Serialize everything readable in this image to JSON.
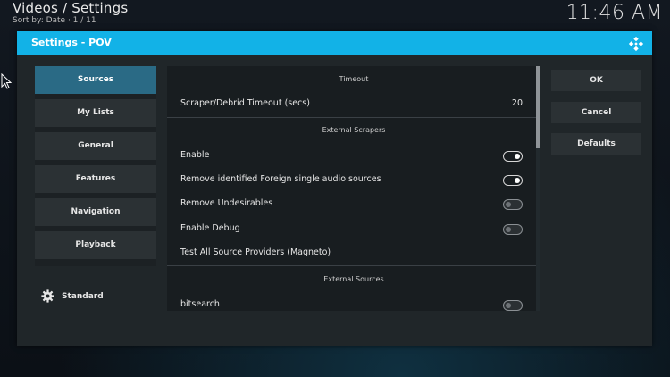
{
  "background": {
    "title": "Videos / Settings",
    "sort_info": "Sort by: Date  ·  1 / 11",
    "clock": "11:46 AM"
  },
  "dialog": {
    "title": "Settings - POV",
    "accent_color": "#12b2e7"
  },
  "categories": [
    {
      "label": "Sources"
    },
    {
      "label": "My Lists"
    },
    {
      "label": "General"
    },
    {
      "label": "Features"
    },
    {
      "label": "Navigation"
    },
    {
      "label": "Playback"
    }
  ],
  "settings_level": {
    "label": "Standard"
  },
  "sections": {
    "timeout": {
      "header": "Timeout",
      "scraper_timeout": {
        "label": "Scraper/Debrid Timeout (secs)",
        "value": "20"
      }
    },
    "external_scrapers": {
      "header": "External Scrapers",
      "enable": {
        "label": "Enable",
        "state": "on"
      },
      "remove_foreign": {
        "label": "Remove identified Foreign single audio sources",
        "state": "on"
      },
      "remove_undesirables": {
        "label": "Remove Undesirables",
        "state": "off"
      },
      "enable_debug": {
        "label": "Enable Debug",
        "state": "off"
      },
      "test_all": {
        "label": "Test All Source Providers (Magneto)"
      }
    },
    "external_sources": {
      "header": "External Sources",
      "bitsearch": {
        "label": "bitsearch",
        "state": "off"
      }
    }
  },
  "buttons": {
    "ok": "OK",
    "cancel": "Cancel",
    "defaults": "Defaults"
  }
}
